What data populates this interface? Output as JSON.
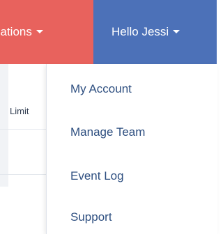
{
  "nav": {
    "left_label": "cations",
    "right_label": "Hello Jessi"
  },
  "table": {
    "column_header": "Limit"
  },
  "dropdown": {
    "items": [
      {
        "label": "My Account"
      },
      {
        "label": "Manage Team"
      },
      {
        "label": "Event Log"
      },
      {
        "label": "Support"
      }
    ]
  },
  "colors": {
    "nav_left_bg": "#e8625d",
    "nav_right_bg": "#4c71b8",
    "dropdown_text": "#2e4f80"
  }
}
